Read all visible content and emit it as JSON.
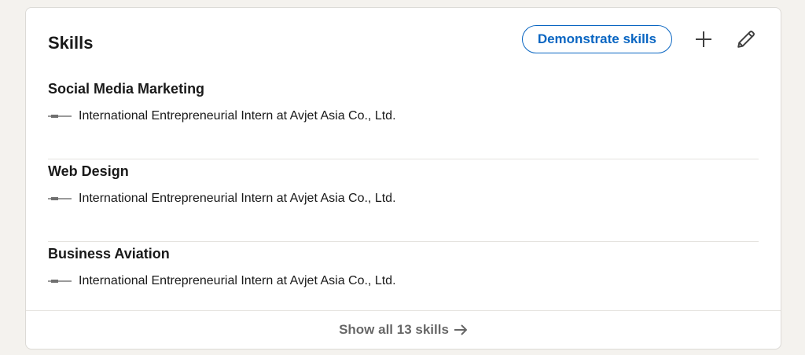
{
  "section": {
    "title": "Skills",
    "demonstrate_label": "Demonstrate skills"
  },
  "icons": {
    "add": "plus-icon",
    "edit": "pencil-icon",
    "arrow": "arrow-right-icon"
  },
  "colors": {
    "accent": "#0a66c2",
    "background": "#f4f2ee",
    "card": "#ffffff",
    "divider": "#e5e3df"
  },
  "skills": [
    {
      "name": "Social Media Marketing",
      "context": "International Entrepreneurial Intern at Avjet Asia Co., Ltd."
    },
    {
      "name": "Web Design",
      "context": "International Entrepreneurial Intern at Avjet Asia Co., Ltd."
    },
    {
      "name": "Business Aviation",
      "context": "International Entrepreneurial Intern at Avjet Asia Co., Ltd."
    }
  ],
  "footer": {
    "show_all_label": "Show all 13 skills"
  }
}
